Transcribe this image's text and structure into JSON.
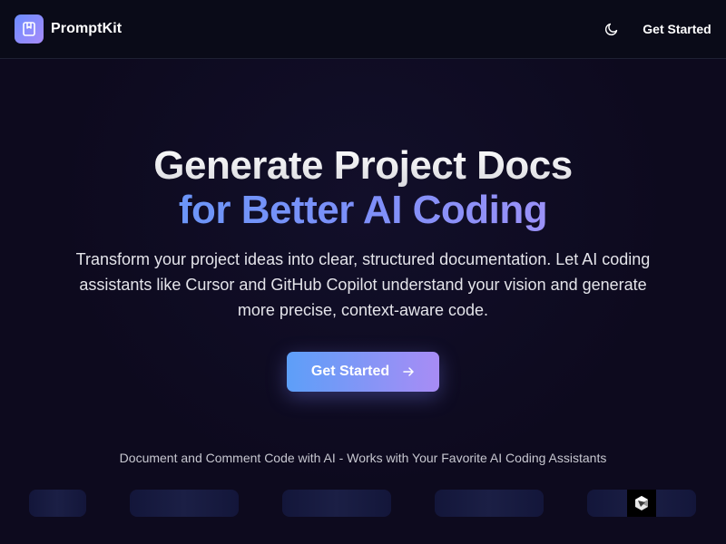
{
  "header": {
    "brand_name": "PromptKit",
    "theme_toggle_icon": "moon-icon",
    "cta_label": "Get Started"
  },
  "hero": {
    "title_line1": "Generate Project Docs",
    "title_line2": "for Better AI Coding",
    "subtitle": "Transform your project ideas into clear, structured documentation. Let AI coding assistants like Cursor and GitHub Copilot understand your vision and generate more precise, context-aware code.",
    "cta_label": "Get Started",
    "cta_icon": "arrow-right-icon"
  },
  "integrations": {
    "tagline": "Document and Comment Code with AI - Works with Your Favorite AI Coding Assistants"
  },
  "colors": {
    "background": "#0d0a1e",
    "accent_start": "#5d9ff8",
    "accent_end": "#a88cf5"
  }
}
